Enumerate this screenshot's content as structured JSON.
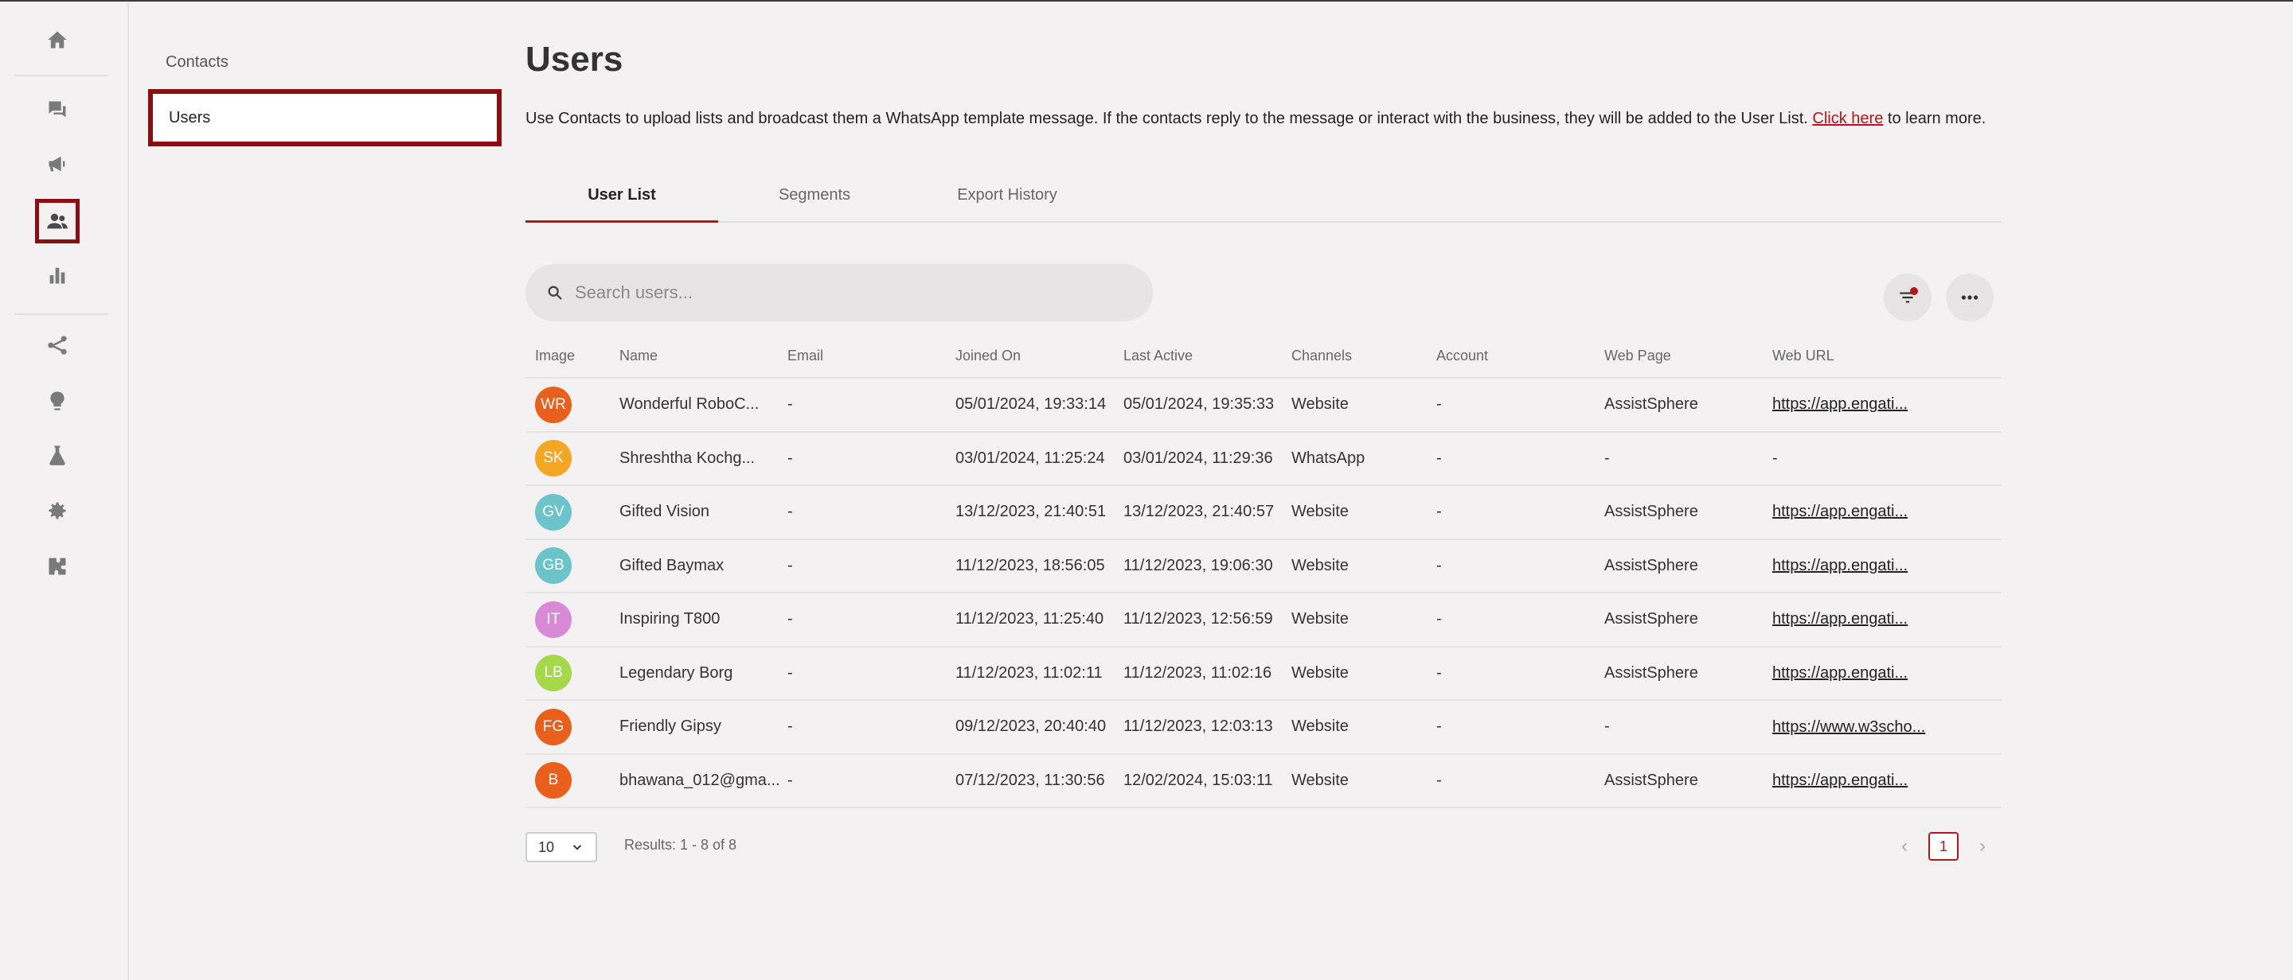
{
  "rail": {
    "icons": [
      "home-icon",
      "chat-icon",
      "megaphone-icon",
      "users-icon",
      "bar-chart-icon",
      "flow-icon",
      "bulb-icon",
      "flask-icon",
      "gear-icon",
      "puzzle-icon"
    ],
    "active": "users-icon",
    "active_color": "#8b0f12"
  },
  "subnav": {
    "items": [
      {
        "label": "Contacts"
      },
      {
        "label": "Users"
      }
    ],
    "active_index": 1
  },
  "header": {
    "title": "Users",
    "description": "Use Contacts to upload lists and broadcast them a WhatsApp template message. If the contacts reply to the message or interact with the business, they will be added to the User List.",
    "link_text": "Click here",
    "description_tail": "to learn more."
  },
  "tabs": [
    {
      "label": "User List"
    },
    {
      "label": "Segments"
    },
    {
      "label": "Export History"
    }
  ],
  "search": {
    "placeholder": "Search users..."
  },
  "table": {
    "columns": [
      "Image",
      "Name",
      "Email",
      "Joined On",
      "Last Active",
      "Channels",
      "Account",
      "Web Page",
      "Web URL"
    ],
    "rows": [
      {
        "initials": "WR",
        "color": "#e8601c",
        "name": "Wonderful RoboC...",
        "email": "-",
        "joined": "05/01/2024, 19:33:14",
        "last_active": "05/01/2024, 19:35:33",
        "channel": "Website",
        "account": "-",
        "web_page": "AssistSphere",
        "web_url": "https://app.engati..."
      },
      {
        "initials": "SK",
        "color": "#f5a623",
        "name": "Shreshtha Kochg...",
        "email": "-",
        "joined": "03/01/2024, 11:25:24",
        "last_active": "03/01/2024, 11:29:36",
        "channel": "WhatsApp",
        "account": "-",
        "web_page": "-",
        "web_url": "-"
      },
      {
        "initials": "GV",
        "color": "#6cc3c9",
        "name": "Gifted Vision",
        "email": "-",
        "joined": "13/12/2023, 21:40:51",
        "last_active": "13/12/2023, 21:40:57",
        "channel": "Website",
        "account": "-",
        "web_page": "AssistSphere",
        "web_url": "https://app.engati..."
      },
      {
        "initials": "GB",
        "color": "#6cc3c9",
        "name": "Gifted Baymax",
        "email": "-",
        "joined": "11/12/2023, 18:56:05",
        "last_active": "11/12/2023, 19:06:30",
        "channel": "Website",
        "account": "-",
        "web_page": "AssistSphere",
        "web_url": "https://app.engati..."
      },
      {
        "initials": "IT",
        "color": "#d98ad6",
        "name": "Inspiring T800",
        "email": "-",
        "joined": "11/12/2023, 11:25:40",
        "last_active": "11/12/2023, 12:56:59",
        "channel": "Website",
        "account": "-",
        "web_page": "AssistSphere",
        "web_url": "https://app.engati..."
      },
      {
        "initials": "LB",
        "color": "#a6d84a",
        "name": "Legendary Borg",
        "email": "-",
        "joined": "11/12/2023, 11:02:11",
        "last_active": "11/12/2023, 11:02:16",
        "channel": "Website",
        "account": "-",
        "web_page": "AssistSphere",
        "web_url": "https://app.engati..."
      },
      {
        "initials": "FG",
        "color": "#e8601c",
        "name": "Friendly Gipsy",
        "email": "-",
        "joined": "09/12/2023, 20:40:40",
        "last_active": "11/12/2023, 12:03:13",
        "channel": "Website",
        "account": "-",
        "web_page": "-",
        "web_url": "https://www.w3scho..."
      },
      {
        "initials": "B",
        "color": "#e8601c",
        "name": "bhawana_012@gma...",
        "email": "-",
        "joined": "07/12/2023, 11:30:56",
        "last_active": "12/02/2024, 15:03:11",
        "channel": "Website",
        "account": "-",
        "web_page": "AssistSphere",
        "web_url": "https://app.engati..."
      }
    ]
  },
  "footer": {
    "page_size": "10",
    "results": "Results: 1 - 8 of 8",
    "current_page": "1"
  }
}
